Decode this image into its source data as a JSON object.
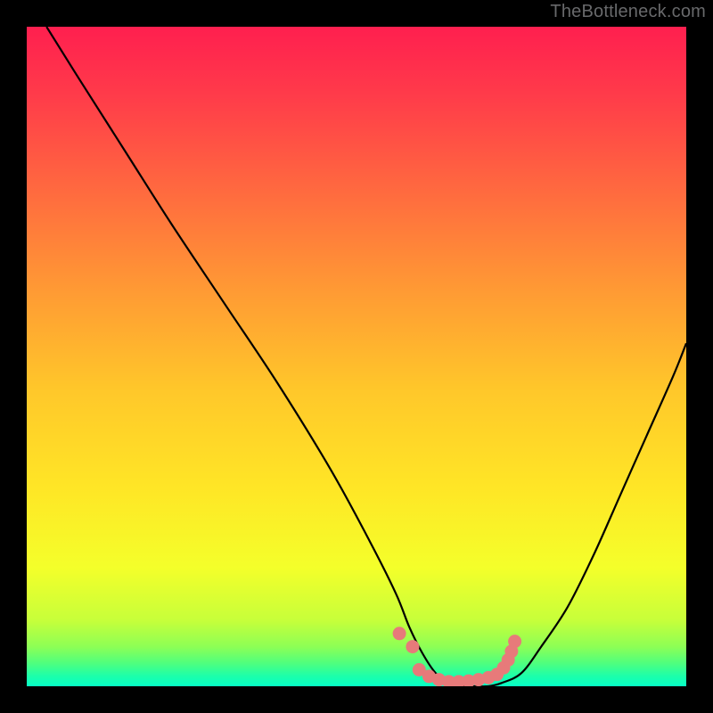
{
  "attribution": "TheBottleneck.com",
  "chart_data": {
    "type": "line",
    "title": "",
    "xlabel": "",
    "ylabel": "",
    "xlim": [
      0,
      100
    ],
    "ylim": [
      0,
      100
    ],
    "series": [
      {
        "name": "bottleneck-curve",
        "x": [
          3,
          8,
          15,
          22,
          30,
          38,
          46,
          52,
          56,
          58,
          60,
          62,
          64,
          66,
          68,
          70,
          72,
          75,
          78,
          82,
          86,
          90,
          94,
          98,
          100
        ],
        "y": [
          100,
          92,
          81,
          70,
          58,
          46,
          33,
          22,
          14,
          9,
          5,
          2,
          0.5,
          0,
          0,
          0,
          0.5,
          2,
          6,
          12,
          20,
          29,
          38,
          47,
          52
        ]
      }
    ],
    "markers": {
      "name": "highlight-points",
      "color": "#e77a7a",
      "points": [
        {
          "x": 56.5,
          "y": 8.0
        },
        {
          "x": 58.5,
          "y": 6.0
        },
        {
          "x": 59.5,
          "y": 2.5
        },
        {
          "x": 61.0,
          "y": 1.5
        },
        {
          "x": 62.5,
          "y": 1.0
        },
        {
          "x": 64.0,
          "y": 0.7
        },
        {
          "x": 65.5,
          "y": 0.7
        },
        {
          "x": 67.0,
          "y": 0.8
        },
        {
          "x": 68.5,
          "y": 1.0
        },
        {
          "x": 70.0,
          "y": 1.3
        },
        {
          "x": 71.3,
          "y": 1.8
        },
        {
          "x": 72.3,
          "y": 2.8
        },
        {
          "x": 73.0,
          "y": 4.0
        },
        {
          "x": 73.5,
          "y": 5.3
        },
        {
          "x": 74.0,
          "y": 6.8
        }
      ]
    },
    "background_gradient": {
      "stops": [
        {
          "offset": 0.0,
          "color": "#ff1f4f"
        },
        {
          "offset": 0.1,
          "color": "#ff3a4a"
        },
        {
          "offset": 0.25,
          "color": "#ff6a3f"
        },
        {
          "offset": 0.4,
          "color": "#ff9a34"
        },
        {
          "offset": 0.55,
          "color": "#ffc72a"
        },
        {
          "offset": 0.7,
          "color": "#ffe626"
        },
        {
          "offset": 0.82,
          "color": "#f4ff2a"
        },
        {
          "offset": 0.9,
          "color": "#c7ff3a"
        },
        {
          "offset": 0.94,
          "color": "#8dff55"
        },
        {
          "offset": 0.965,
          "color": "#4fff7e"
        },
        {
          "offset": 0.985,
          "color": "#1bffab"
        },
        {
          "offset": 1.0,
          "color": "#06ffc5"
        }
      ]
    }
  }
}
